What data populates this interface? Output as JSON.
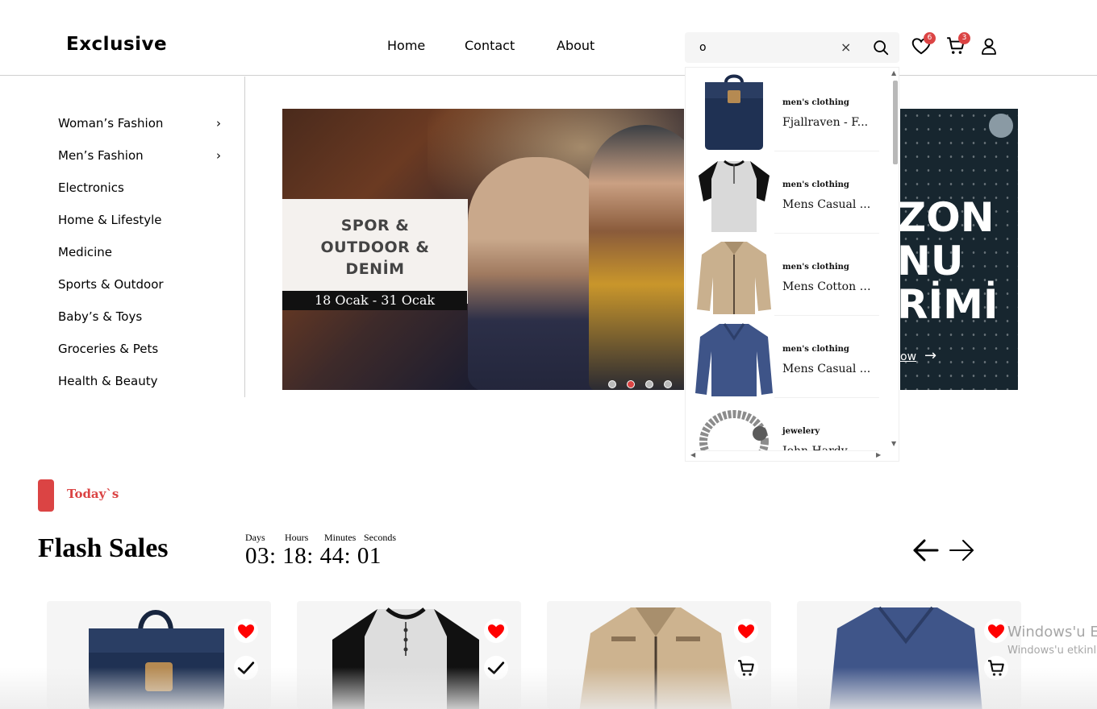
{
  "header": {
    "logo": "Exclusive",
    "nav": [
      "Home",
      "Contact",
      "About"
    ],
    "search": {
      "value": "o",
      "clear_label": "×"
    },
    "wishlist_count": "6",
    "cart_count": "3",
    "icons": [
      "search-icon",
      "heart-icon",
      "cart-icon",
      "user-icon"
    ]
  },
  "sidebar": {
    "items": [
      {
        "label": "Woman’s Fashion",
        "has_submenu": true
      },
      {
        "label": "Men’s Fashion",
        "has_submenu": true
      },
      {
        "label": "Electronics"
      },
      {
        "label": "Home & Lifestyle"
      },
      {
        "label": "Medicine"
      },
      {
        "label": "Sports & Outdoor"
      },
      {
        "label": "Baby’s & Toys"
      },
      {
        "label": "Groceries & Pets"
      },
      {
        "label": "Health & Beauty"
      }
    ],
    "chevron": "›"
  },
  "banner": {
    "line1": "SPOR &",
    "line2": "OUTDOOR &",
    "line3": "DENİM",
    "dates": "18 Ocak - 31 Ocak",
    "slide_count": 4,
    "active_slide": 2
  },
  "banner_right": {
    "line1": "ZON",
    "line2": "NU",
    "line3": "RİMİ",
    "shop": "ow"
  },
  "dropdown": {
    "items": [
      {
        "category": "men's clothing",
        "title": "Fjallraven - F..."
      },
      {
        "category": "men's clothing",
        "title": "Mens Casual ..."
      },
      {
        "category": "men's clothing",
        "title": "Mens Cotton J..."
      },
      {
        "category": "men's clothing",
        "title": "Mens Casual ..."
      },
      {
        "category": "jewelery",
        "title": "John Hardy W..."
      }
    ]
  },
  "flash": {
    "tag": "Today`s",
    "title": "Flash Sales",
    "labels": {
      "days": "Days",
      "hours": "Hours",
      "minutes": "Minutes",
      "seconds": "Seconds"
    },
    "time": "03: 18: 44: 01"
  },
  "colors": {
    "accent": "#db4444",
    "bg": "#ffffff",
    "card": "#f5f5f5"
  },
  "watermark": {
    "line1": "Windows'u E",
    "line2": "Windows'u etkinl"
  }
}
